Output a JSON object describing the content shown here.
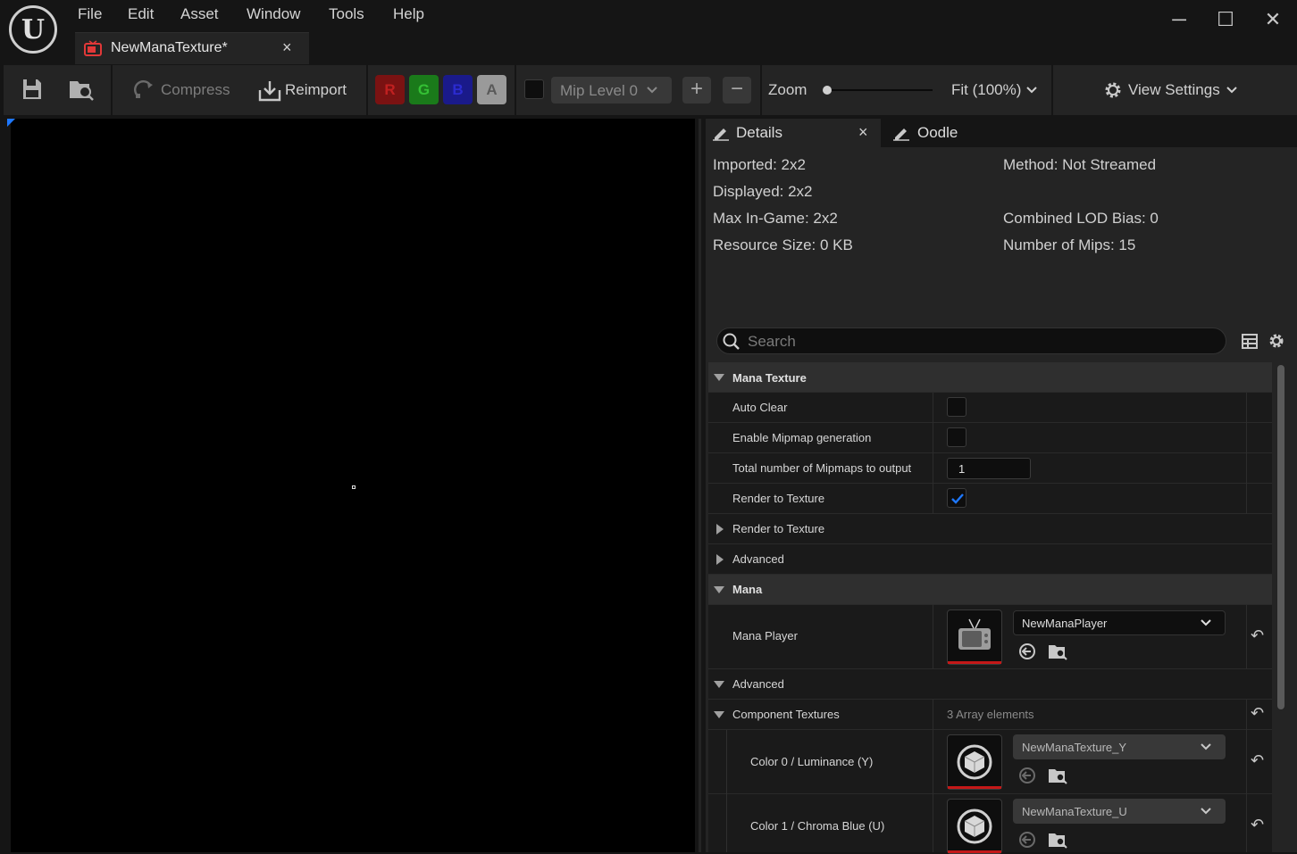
{
  "app": {
    "logo_glyph": "U",
    "menu": [
      "File",
      "Edit",
      "Asset",
      "Window",
      "Tools",
      "Help"
    ],
    "window_controls": {
      "minimize": "─",
      "maximize": "☐",
      "close": "✕"
    }
  },
  "tab": {
    "title": "NewManaTexture*",
    "close": "×"
  },
  "toolbar": {
    "compress": "Compress",
    "reimport": "Reimport",
    "channels": [
      {
        "label": "R",
        "bg": "#7a1212",
        "fg": "#c02020"
      },
      {
        "label": "G",
        "bg": "#1a7a1a",
        "fg": "#34c034"
      },
      {
        "label": "B",
        "bg": "#1a1a8a",
        "fg": "#2b2bd0"
      },
      {
        "label": "A",
        "bg": "#9a9a9a",
        "fg": "#5a5a5a"
      }
    ],
    "mip_level": "Mip Level 0",
    "plus": "+",
    "minus": "−",
    "zoom_label": "Zoom",
    "zoom_slider_level": 0,
    "fit": "Fit (100%)",
    "view_settings": "View Settings"
  },
  "details": {
    "tab_details": "Details",
    "tab_details_close": "×",
    "tab_oodle": "Oodle",
    "info_left": [
      "Imported: 2x2",
      "Displayed: 2x2",
      "Max In-Game: 2x2",
      "Resource Size: 0 KB"
    ],
    "info_right": [
      "Method: Not Streamed",
      "",
      "Combined LOD Bias: 0",
      "Number of Mips: 15"
    ],
    "search_placeholder": "Search",
    "rows": {
      "mana_texture": "Mana Texture",
      "auto_clear": "Auto Clear",
      "enable_mipmap": "Enable Mipmap generation",
      "total_mipmaps": "Total number of Mipmaps to output",
      "total_mipmaps_value": "1",
      "render_to_texture_prop": "Render to Texture",
      "render_to_texture_cat": "Render to Texture",
      "advanced_1": "Advanced",
      "mana": "Mana",
      "mana_player": "Mana Player",
      "mana_player_value": "NewManaPlayer",
      "advanced_2": "Advanced",
      "component_textures": "Component Textures",
      "array_elements": "3 Array elements",
      "color0": "Color 0 / Luminance (Y)",
      "color0_value": "NewManaTexture_Y",
      "color1": "Color 1 / Chroma Blue (U)",
      "color1_value": "NewManaTexture_U"
    }
  }
}
